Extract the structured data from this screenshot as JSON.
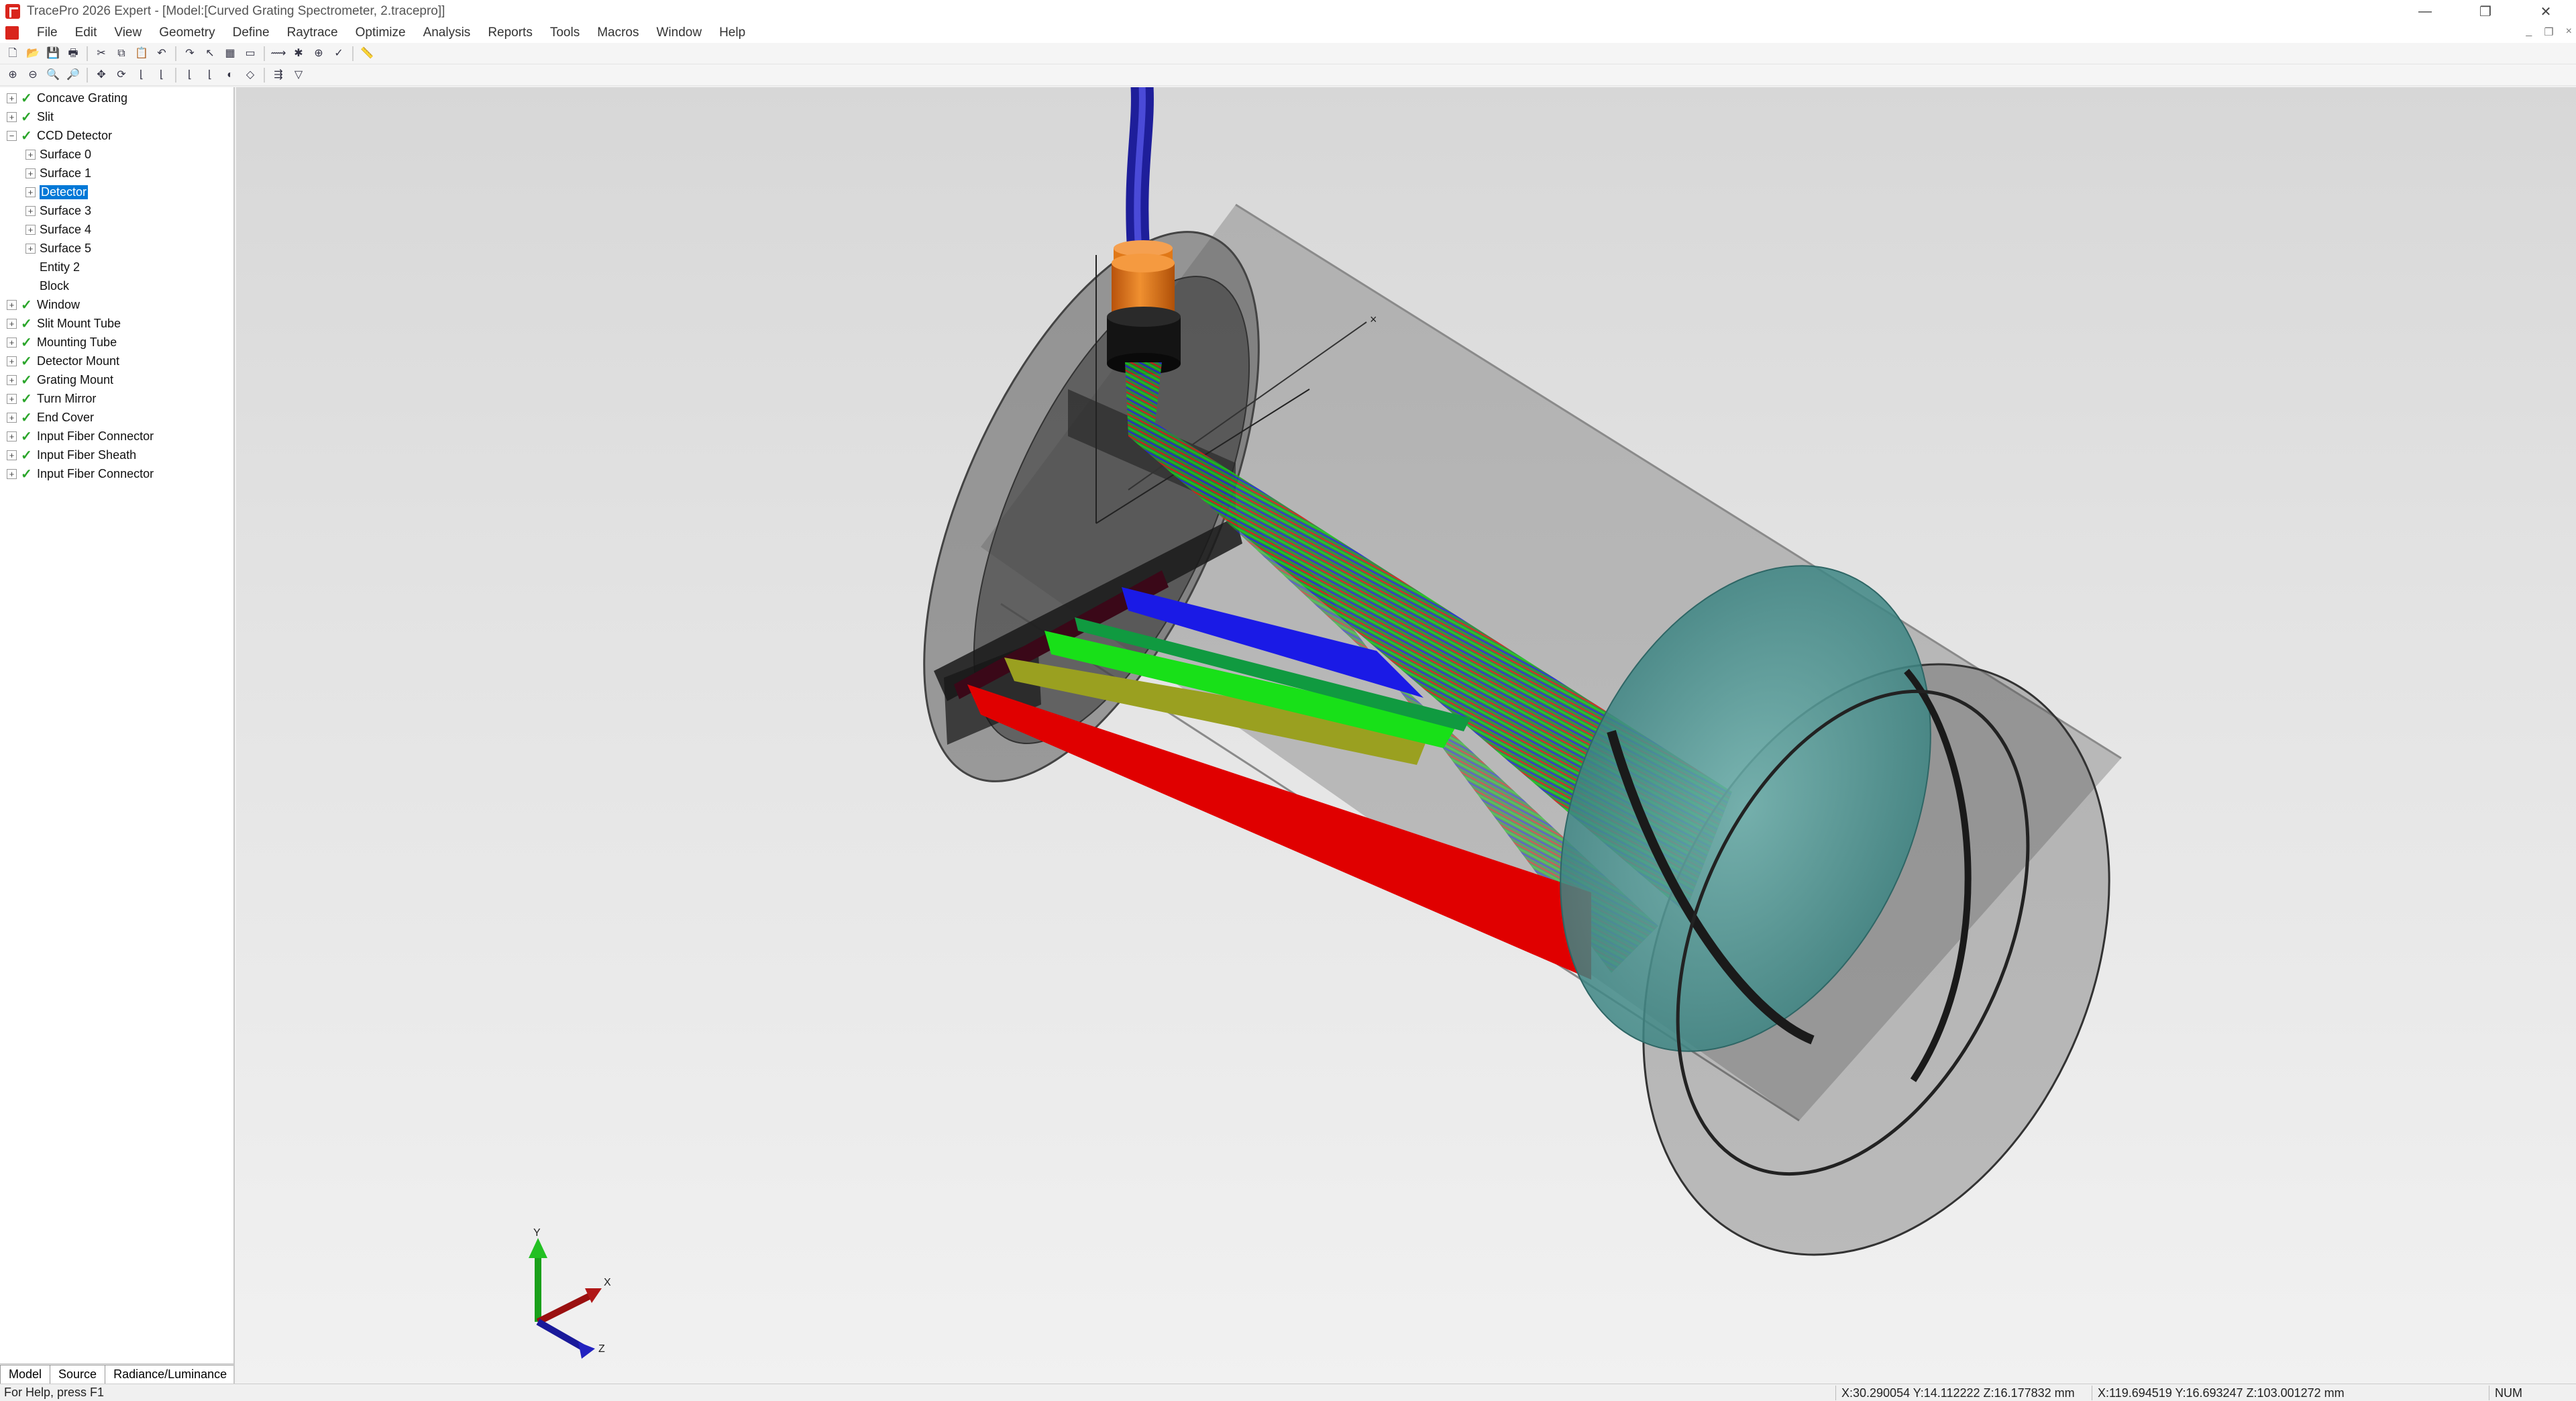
{
  "window": {
    "title": "TracePro 2026 Expert - [Model:[Curved Grating Spectrometer, 2.tracepro]]",
    "minimize_glyph": "—",
    "restore_glyph": "❐",
    "close_glyph": "✕"
  },
  "menu": [
    "File",
    "Edit",
    "View",
    "Geometry",
    "Define",
    "Raytrace",
    "Optimize",
    "Analysis",
    "Reports",
    "Tools",
    "Macros",
    "Window",
    "Help"
  ],
  "toolbar1": [
    {
      "icon": "new-file-icon",
      "glyph": "🗋"
    },
    {
      "icon": "open-folder-icon",
      "glyph": "📂"
    },
    {
      "icon": "save-icon",
      "glyph": "💾"
    },
    {
      "icon": "print-icon",
      "glyph": "🖶"
    },
    {
      "icon": "cut-icon",
      "glyph": "✂"
    },
    {
      "icon": "copy-icon",
      "glyph": "⧉"
    },
    {
      "icon": "paste-icon",
      "glyph": "📋"
    },
    {
      "icon": "undo-icon",
      "glyph": "↶"
    },
    {
      "icon": "redo-icon",
      "glyph": "↷"
    },
    {
      "icon": "select-icon",
      "glyph": "↖"
    },
    {
      "icon": "grid-icon",
      "glyph": "▦"
    },
    {
      "icon": "window-icon",
      "glyph": "▭"
    },
    {
      "icon": "trace-rays-icon",
      "glyph": "⟿"
    },
    {
      "icon": "source-icon",
      "glyph": "✱"
    },
    {
      "icon": "analysis-icon",
      "glyph": "⊕"
    },
    {
      "icon": "check-icon",
      "glyph": "✓"
    },
    {
      "icon": "ruler-icon",
      "glyph": "📏"
    }
  ],
  "toolbar2": [
    {
      "icon": "zoom-in-icon",
      "glyph": "⊕"
    },
    {
      "icon": "zoom-out-icon",
      "glyph": "⊖"
    },
    {
      "icon": "zoom-window-icon",
      "glyph": "🔍"
    },
    {
      "icon": "zoom-all-icon",
      "glyph": "🔎"
    },
    {
      "icon": "pan-icon",
      "glyph": "✥"
    },
    {
      "icon": "rotate-icon",
      "glyph": "⟳"
    },
    {
      "icon": "view-xy-icon",
      "glyph": "⌊"
    },
    {
      "icon": "view-yz-icon",
      "glyph": "⌊"
    },
    {
      "icon": "view-xz-icon",
      "glyph": "⌊"
    },
    {
      "icon": "iso-view-icon",
      "glyph": "⌊"
    },
    {
      "icon": "shade-icon",
      "glyph": "◐"
    },
    {
      "icon": "wireframe-icon",
      "glyph": "◇"
    },
    {
      "icon": "rays-icon",
      "glyph": "⇶"
    },
    {
      "icon": "filter-icon",
      "glyph": "▽"
    }
  ],
  "tree": [
    {
      "label": "Concave Grating",
      "level": 0,
      "check": true,
      "expander": "+"
    },
    {
      "label": "Slit",
      "level": 0,
      "check": true,
      "expander": "+"
    },
    {
      "label": "CCD Detector",
      "level": 0,
      "check": true,
      "expander": "−"
    },
    {
      "label": "Surface 0",
      "level": 1,
      "check": false,
      "expander": "+"
    },
    {
      "label": "Surface 1",
      "level": 1,
      "check": false,
      "expander": "+"
    },
    {
      "label": "Detector",
      "level": 1,
      "check": false,
      "expander": "+",
      "selected": true
    },
    {
      "label": "Surface 3",
      "level": 1,
      "check": false,
      "expander": "+"
    },
    {
      "label": "Surface 4",
      "level": 1,
      "check": false,
      "expander": "+"
    },
    {
      "label": "Surface 5",
      "level": 1,
      "check": false,
      "expander": "+"
    },
    {
      "label": "Entity 2",
      "level": 1,
      "check": false,
      "expander": ""
    },
    {
      "label": "Block",
      "level": 1,
      "check": false,
      "expander": ""
    },
    {
      "label": "Window",
      "level": 0,
      "check": true,
      "expander": "+"
    },
    {
      "label": "Slit Mount Tube",
      "level": 0,
      "check": true,
      "expander": "+"
    },
    {
      "label": "Mounting Tube",
      "level": 0,
      "check": true,
      "expander": "+"
    },
    {
      "label": "Detector Mount",
      "level": 0,
      "check": true,
      "expander": "+"
    },
    {
      "label": "Grating Mount",
      "level": 0,
      "check": true,
      "expander": "+"
    },
    {
      "label": "Turn Mirror",
      "level": 0,
      "check": true,
      "expander": "+"
    },
    {
      "label": "End Cover",
      "level": 0,
      "check": true,
      "expander": "+"
    },
    {
      "label": "Input Fiber Connector",
      "level": 0,
      "check": true,
      "expander": "+"
    },
    {
      "label": "Input Fiber Sheath",
      "level": 0,
      "check": true,
      "expander": "+"
    },
    {
      "label": "Input Fiber Connector",
      "level": 0,
      "check": true,
      "expander": "+"
    }
  ],
  "tree_tabs": [
    "Model",
    "Source",
    "Radiance/Luminance"
  ],
  "axes": {
    "x": "X",
    "y": "Y",
    "z": "Z"
  },
  "colors": {
    "ray_red": "#e00000",
    "ray_green": "#18e018",
    "ray_blue": "#1a1ae6",
    "ray_yellow": "#9aa020",
    "fiber_blue": "#2424b0",
    "connector_orange": "#e07818",
    "lens_teal": "#4f9a98"
  },
  "status": {
    "help": "For Help, press F1",
    "coord1": "X:30.290054 Y:14.112222 Z:16.177832 mm",
    "coord2": "X:119.694519 Y:16.693247 Z:103.001272 mm",
    "num": "NUM"
  }
}
